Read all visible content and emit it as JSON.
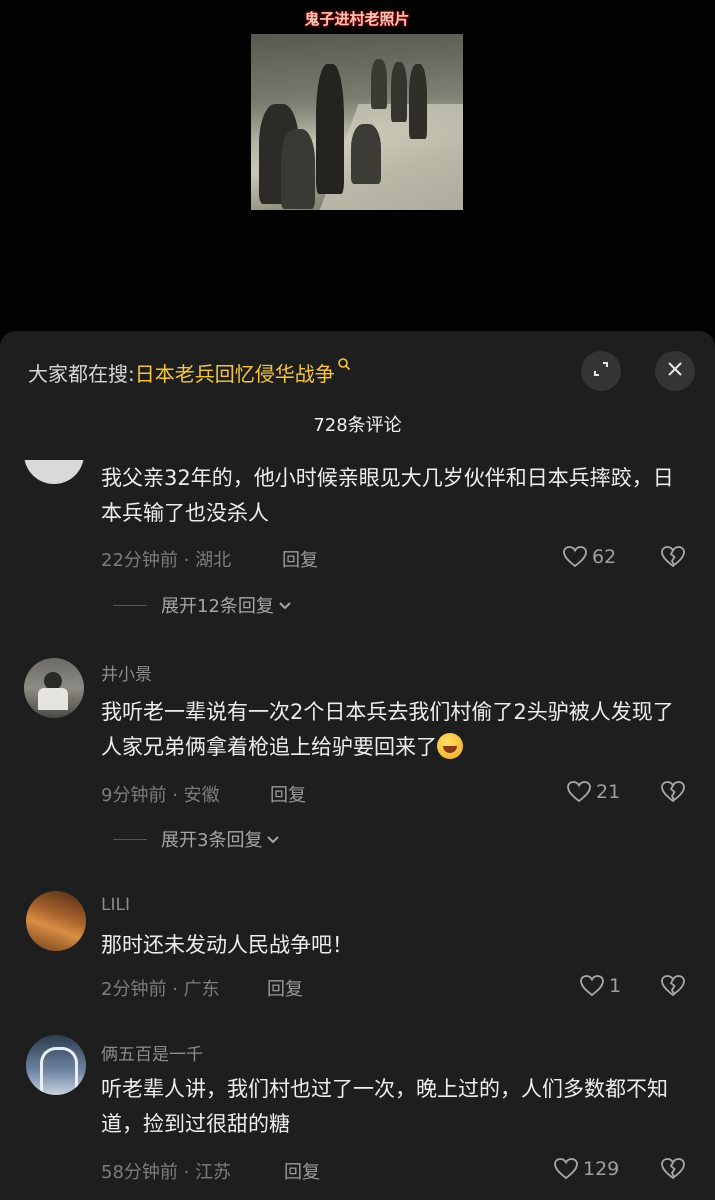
{
  "video": {
    "caption": "鬼子进村老照片"
  },
  "search": {
    "prefix": "大家都在搜:",
    "term": "日本老兵回忆侵华战争"
  },
  "comments_header": {
    "count_text": "728条评论"
  },
  "comments": [
    {
      "username": "",
      "text": "我父亲32年的，他小时候亲眼见大几岁伙伴和日本兵摔跤，日本兵输了也没杀人",
      "time_location": "22分钟前 · 湖北",
      "reply_label": "回复",
      "likes": "62",
      "expand_label": "展开12条回复"
    },
    {
      "username": "井小景",
      "text": "我听老一辈说有一次2个日本兵去我们村偷了2头驴被人发现了人家兄弟俩拿着枪追上给驴要回来了",
      "time_location": "9分钟前 · 安徽",
      "reply_label": "回复",
      "likes": "21",
      "expand_label": "展开3条回复"
    },
    {
      "username": "LILI",
      "text": "那时还未发动人民战争吧！",
      "time_location": "2分钟前 · 广东",
      "reply_label": "回复",
      "likes": "1"
    },
    {
      "username": "俩五百是一千",
      "text": "听老辈人讲，我们村也过了一次，晚上过的，人们多数都不知道，捡到过很甜的糖",
      "time_location": "58分钟前 · 江苏",
      "reply_label": "回复",
      "likes": "129"
    }
  ],
  "colors": {
    "accent": "#f5c542",
    "sheet_bg": "#1e1e1e",
    "page_bg": "#000000"
  }
}
